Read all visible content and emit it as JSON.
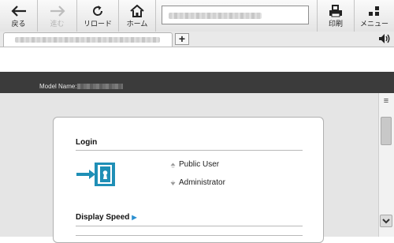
{
  "toolbar": {
    "back_label": "戻る",
    "forward_label": "進む",
    "reload_label": "リロード",
    "home_label": "ホーム",
    "print_label": "印刷",
    "menu_label": "メニュー"
  },
  "tabbar": {
    "new_tab": "+"
  },
  "page": {
    "model_name_label": "Model Name:",
    "login": {
      "title": "Login",
      "options": [
        "Public User",
        "Administrator"
      ]
    },
    "display_speed": {
      "title": "Display Speed",
      "arrow": "▶"
    }
  },
  "scrollbar": {
    "menu_glyph": "≡"
  },
  "colors": {
    "header_bar": "#3b3b3b",
    "content_bg": "#e5e5e5",
    "login_icon": "#1f8fb6",
    "accent_arrow": "#2b8fd0"
  },
  "icons": [
    "back-arrow-icon",
    "forward-arrow-icon",
    "reload-icon",
    "home-icon",
    "print-icon",
    "menu-dots-icon",
    "speaker-icon",
    "login-door-icon",
    "scroll-menu-icon",
    "scroll-down-icon"
  ]
}
